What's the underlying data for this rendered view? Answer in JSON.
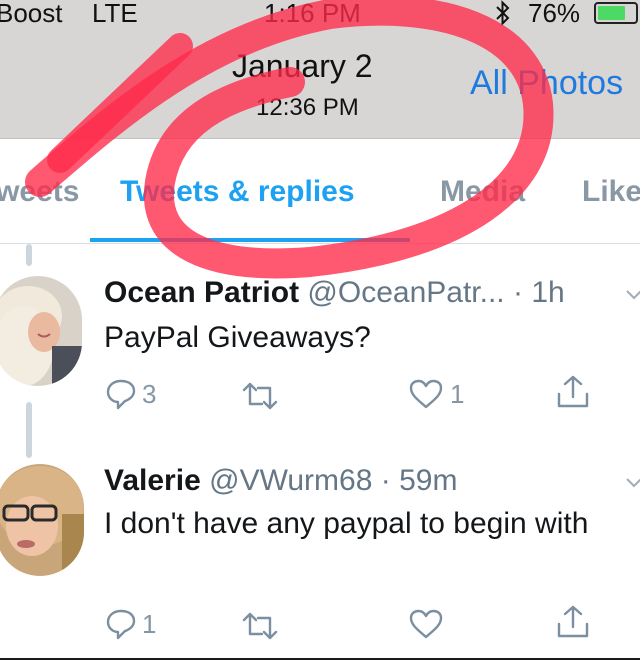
{
  "status_bar": {
    "carrier": "Boost",
    "network": "LTE",
    "time": "1:16 PM",
    "battery_percent": "76%",
    "battery_level": 0.76
  },
  "photo_header": {
    "date": "January 2",
    "time": "12:36 PM",
    "all_photos_label": "All Photos"
  },
  "tabs": {
    "items": [
      {
        "label": "Tweets"
      },
      {
        "label": "Tweets & replies"
      },
      {
        "label": "Media"
      },
      {
        "label": "Likes"
      }
    ],
    "active_index": 1
  },
  "tweets": [
    {
      "name": "Ocean Patriot",
      "handle": "@OceanPatr...",
      "separator": "·",
      "time": "1h",
      "text": "PayPal Giveaways?",
      "replies": "3",
      "retweets": "",
      "likes": "1"
    },
    {
      "name": "Valerie",
      "handle": "@VWurm68",
      "separator": "·",
      "time": "59m",
      "text": "I don't have any paypal to begin with",
      "replies": "1",
      "retweets": "",
      "likes": ""
    }
  ],
  "colors": {
    "accent": "#1da1f2",
    "annotation": "#ff2a4a",
    "ios_link": "#1f7ae0",
    "battery": "#4cd964"
  },
  "icons": [
    "bluetooth-icon",
    "battery-icon",
    "reply-icon",
    "retweet-icon",
    "heart-icon",
    "share-icon",
    "chevron-down-icon"
  ]
}
